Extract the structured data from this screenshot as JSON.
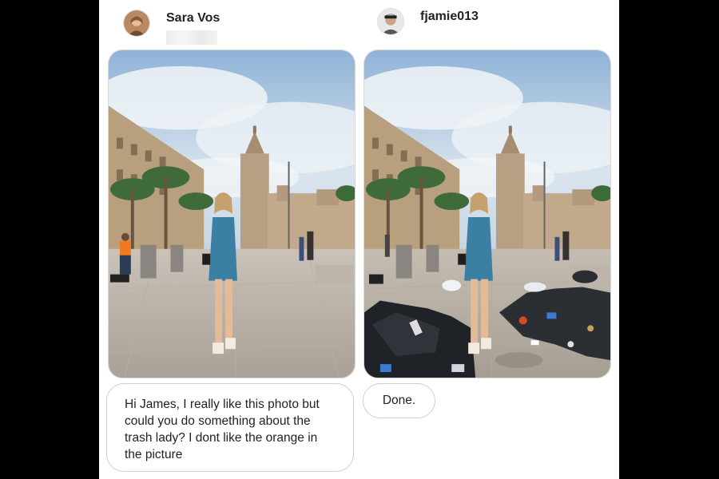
{
  "left_user": {
    "name": "Sara Vos",
    "avatar_icon": "profile-photo-icon"
  },
  "right_user": {
    "name": "fjamie013",
    "avatar_icon": "profile-photo-icon"
  },
  "messages": {
    "left_text": "Hi James,  I really like this photo but could you do something about the trash lady? I dont like the orange in the picture",
    "right_text": "Done."
  },
  "colors": {
    "background": "#000000",
    "panel": "#ffffff",
    "bubble_border": "#cfcfcf"
  }
}
